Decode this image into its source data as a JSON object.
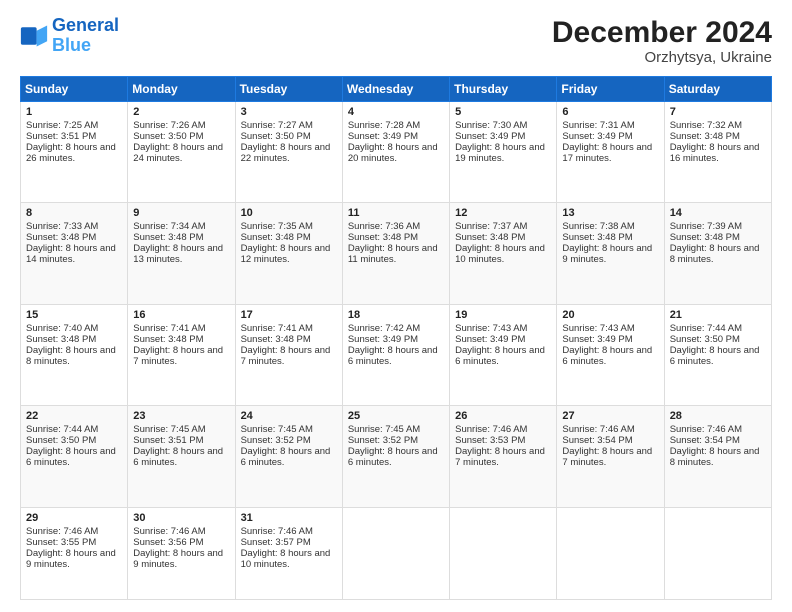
{
  "logo": {
    "line1": "General",
    "line2": "Blue"
  },
  "title": "December 2024",
  "subtitle": "Orzhytsya, Ukraine",
  "days_of_week": [
    "Sunday",
    "Monday",
    "Tuesday",
    "Wednesday",
    "Thursday",
    "Friday",
    "Saturday"
  ],
  "weeks": [
    [
      {
        "day": 1,
        "sunrise": "7:25 AM",
        "sunset": "3:51 PM",
        "daylight": "8 hours and 26 minutes."
      },
      {
        "day": 2,
        "sunrise": "7:26 AM",
        "sunset": "3:50 PM",
        "daylight": "8 hours and 24 minutes."
      },
      {
        "day": 3,
        "sunrise": "7:27 AM",
        "sunset": "3:50 PM",
        "daylight": "8 hours and 22 minutes."
      },
      {
        "day": 4,
        "sunrise": "7:28 AM",
        "sunset": "3:49 PM",
        "daylight": "8 hours and 20 minutes."
      },
      {
        "day": 5,
        "sunrise": "7:30 AM",
        "sunset": "3:49 PM",
        "daylight": "8 hours and 19 minutes."
      },
      {
        "day": 6,
        "sunrise": "7:31 AM",
        "sunset": "3:49 PM",
        "daylight": "8 hours and 17 minutes."
      },
      {
        "day": 7,
        "sunrise": "7:32 AM",
        "sunset": "3:48 PM",
        "daylight": "8 hours and 16 minutes."
      }
    ],
    [
      {
        "day": 8,
        "sunrise": "7:33 AM",
        "sunset": "3:48 PM",
        "daylight": "8 hours and 14 minutes."
      },
      {
        "day": 9,
        "sunrise": "7:34 AM",
        "sunset": "3:48 PM",
        "daylight": "8 hours and 13 minutes."
      },
      {
        "day": 10,
        "sunrise": "7:35 AM",
        "sunset": "3:48 PM",
        "daylight": "8 hours and 12 minutes."
      },
      {
        "day": 11,
        "sunrise": "7:36 AM",
        "sunset": "3:48 PM",
        "daylight": "8 hours and 11 minutes."
      },
      {
        "day": 12,
        "sunrise": "7:37 AM",
        "sunset": "3:48 PM",
        "daylight": "8 hours and 10 minutes."
      },
      {
        "day": 13,
        "sunrise": "7:38 AM",
        "sunset": "3:48 PM",
        "daylight": "8 hours and 9 minutes."
      },
      {
        "day": 14,
        "sunrise": "7:39 AM",
        "sunset": "3:48 PM",
        "daylight": "8 hours and 8 minutes."
      }
    ],
    [
      {
        "day": 15,
        "sunrise": "7:40 AM",
        "sunset": "3:48 PM",
        "daylight": "8 hours and 8 minutes."
      },
      {
        "day": 16,
        "sunrise": "7:41 AM",
        "sunset": "3:48 PM",
        "daylight": "8 hours and 7 minutes."
      },
      {
        "day": 17,
        "sunrise": "7:41 AM",
        "sunset": "3:48 PM",
        "daylight": "8 hours and 7 minutes."
      },
      {
        "day": 18,
        "sunrise": "7:42 AM",
        "sunset": "3:49 PM",
        "daylight": "8 hours and 6 minutes."
      },
      {
        "day": 19,
        "sunrise": "7:43 AM",
        "sunset": "3:49 PM",
        "daylight": "8 hours and 6 minutes."
      },
      {
        "day": 20,
        "sunrise": "7:43 AM",
        "sunset": "3:49 PM",
        "daylight": "8 hours and 6 minutes."
      },
      {
        "day": 21,
        "sunrise": "7:44 AM",
        "sunset": "3:50 PM",
        "daylight": "8 hours and 6 minutes."
      }
    ],
    [
      {
        "day": 22,
        "sunrise": "7:44 AM",
        "sunset": "3:50 PM",
        "daylight": "8 hours and 6 minutes."
      },
      {
        "day": 23,
        "sunrise": "7:45 AM",
        "sunset": "3:51 PM",
        "daylight": "8 hours and 6 minutes."
      },
      {
        "day": 24,
        "sunrise": "7:45 AM",
        "sunset": "3:52 PM",
        "daylight": "8 hours and 6 minutes."
      },
      {
        "day": 25,
        "sunrise": "7:45 AM",
        "sunset": "3:52 PM",
        "daylight": "8 hours and 6 minutes."
      },
      {
        "day": 26,
        "sunrise": "7:46 AM",
        "sunset": "3:53 PM",
        "daylight": "8 hours and 7 minutes."
      },
      {
        "day": 27,
        "sunrise": "7:46 AM",
        "sunset": "3:54 PM",
        "daylight": "8 hours and 7 minutes."
      },
      {
        "day": 28,
        "sunrise": "7:46 AM",
        "sunset": "3:54 PM",
        "daylight": "8 hours and 8 minutes."
      }
    ],
    [
      {
        "day": 29,
        "sunrise": "7:46 AM",
        "sunset": "3:55 PM",
        "daylight": "8 hours and 9 minutes."
      },
      {
        "day": 30,
        "sunrise": "7:46 AM",
        "sunset": "3:56 PM",
        "daylight": "8 hours and 9 minutes."
      },
      {
        "day": 31,
        "sunrise": "7:46 AM",
        "sunset": "3:57 PM",
        "daylight": "8 hours and 10 minutes."
      },
      null,
      null,
      null,
      null
    ]
  ]
}
